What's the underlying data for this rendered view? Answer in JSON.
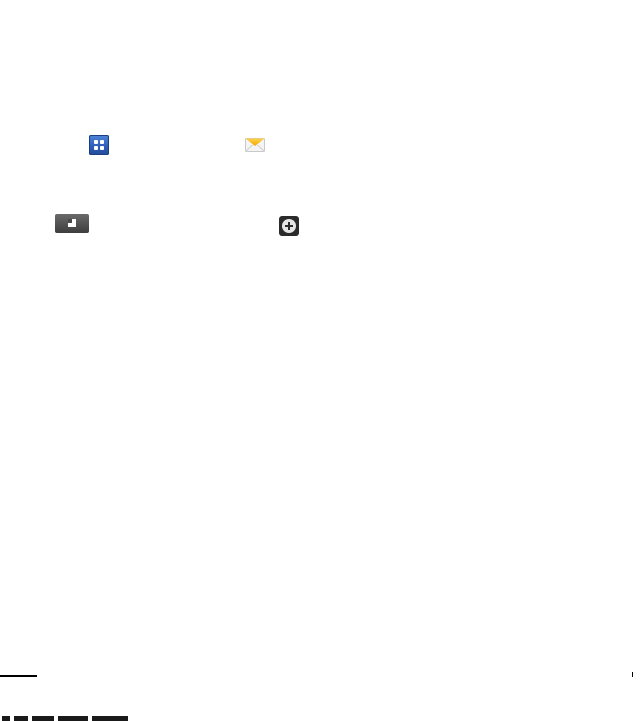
{
  "icons": {
    "apps": "apps-grid-icon",
    "email": "email-icon",
    "recent": "recent-apps-key-icon",
    "add": "add-circle-icon"
  },
  "colors": {
    "apps_blue": "#2f5fb8",
    "email_yellow": "#f4b400",
    "key_gray": "#4a4a4a",
    "background": "#ffffff"
  }
}
